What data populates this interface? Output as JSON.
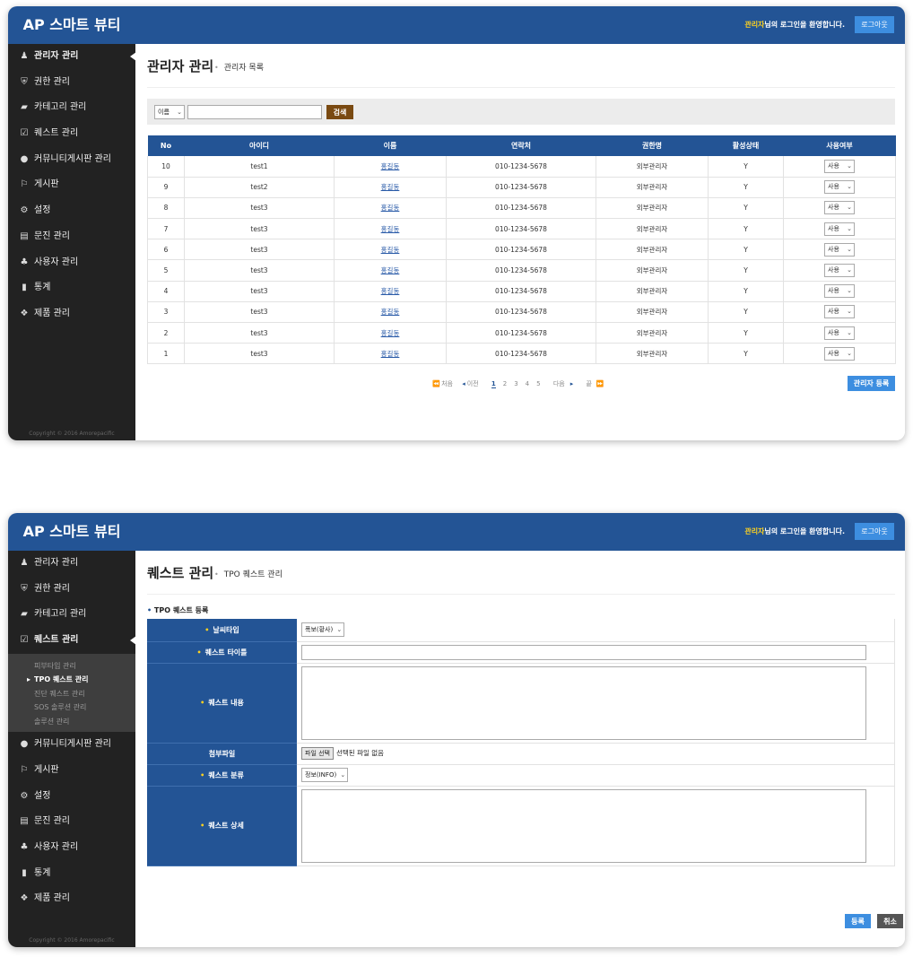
{
  "brand": "AP 스마트 뷰티",
  "header": {
    "welcome_name": "관리자",
    "welcome_text": "님의 로그인을 환영합니다.",
    "logout": "로그아웃"
  },
  "sidebar": {
    "items": [
      {
        "label": "관리자 관리",
        "icon": "user-icon"
      },
      {
        "label": "권한 관리",
        "icon": "shield-icon"
      },
      {
        "label": "카테고리 관리",
        "icon": "folder-icon"
      },
      {
        "label": "퀘스트 관리",
        "icon": "checklist-icon"
      },
      {
        "label": "커뮤니티게시판 관리",
        "icon": "chat-icon"
      },
      {
        "label": "게시판",
        "icon": "signpost-icon"
      },
      {
        "label": "설정",
        "icon": "gear-icon"
      },
      {
        "label": "문진 관리",
        "icon": "document-search-icon"
      },
      {
        "label": "사용자 관리",
        "icon": "users-icon"
      },
      {
        "label": "통계",
        "icon": "bar-chart-icon"
      },
      {
        "label": "제품 관리",
        "icon": "box-icon"
      }
    ],
    "subitems": [
      "피부타입 관리",
      "TPO 퀘스트 관리",
      "진단 퀘스트 관리",
      "SOS 솔루션 관리",
      "솔루션 관리"
    ],
    "copyright": "Copyright © 2016 Amorepacific"
  },
  "screen1": {
    "title": "관리자 관리",
    "subtitle": "관리자 목록",
    "search": {
      "select_value": "이름",
      "input_value": "",
      "button": "검색"
    },
    "table": {
      "headers": [
        "No",
        "아이디",
        "이름",
        "연락처",
        "권한명",
        "활성상태",
        "사용여부"
      ],
      "rows": [
        [
          "10",
          "test1",
          "홍길동",
          "010-1234-5678",
          "외부관리자",
          "Y",
          "사용"
        ],
        [
          "9",
          "test2",
          "홍길동",
          "010-1234-5678",
          "외부관리자",
          "Y",
          "사용"
        ],
        [
          "8",
          "test3",
          "홍길동",
          "010-1234-5678",
          "외부관리자",
          "Y",
          "사용"
        ],
        [
          "7",
          "test3",
          "홍길동",
          "010-1234-5678",
          "외부관리자",
          "Y",
          "사용"
        ],
        [
          "6",
          "test3",
          "홍길동",
          "010-1234-5678",
          "외부관리자",
          "Y",
          "사용"
        ],
        [
          "5",
          "test3",
          "홍길동",
          "010-1234-5678",
          "외부관리자",
          "Y",
          "사용"
        ],
        [
          "4",
          "test3",
          "홍길동",
          "010-1234-5678",
          "외부관리자",
          "Y",
          "사용"
        ],
        [
          "3",
          "test3",
          "홍길동",
          "010-1234-5678",
          "외부관리자",
          "Y",
          "사용"
        ],
        [
          "2",
          "test3",
          "홍길동",
          "010-1234-5678",
          "외부관리자",
          "Y",
          "사용"
        ],
        [
          "1",
          "test3",
          "홍길동",
          "010-1234-5678",
          "외부관리자",
          "Y",
          "사용"
        ]
      ]
    },
    "pagination": {
      "first": "처음",
      "prev": "이전",
      "pages": [
        "1",
        "2",
        "3",
        "4",
        "5"
      ],
      "current": "1",
      "next": "다음",
      "last": "끝"
    },
    "register_button": "관리자 등록"
  },
  "screen2": {
    "title": "퀘스트 관리",
    "subtitle": "TPO 퀘스트 관리",
    "section": "TPO 퀘스트 등록",
    "form": {
      "weather_label": "날씨타입",
      "weather_value": "폭보(황사)",
      "quest_title_label": "퀘스트 타이틀",
      "quest_title_value": "",
      "quest_content_label": "퀘스트 내용",
      "attachment_label": "첨부파일",
      "file_button": "파일 선택",
      "file_status": "선택된 파일 없음",
      "category_label": "퀘스트 분류",
      "category_value": "정보(INFO)",
      "detail_label": "퀘스트 상세"
    },
    "save_button": "등록",
    "cancel_button": "취소"
  },
  "colors": {
    "header_blue": "#235495",
    "sidebar_dark": "#222222",
    "accent_blue": "#3d8ee0",
    "search_brown": "#7a4a12",
    "highlight_yellow": "#ffd21f"
  }
}
